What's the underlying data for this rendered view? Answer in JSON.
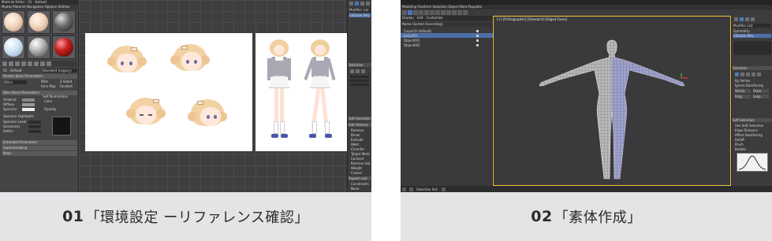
{
  "panels": [
    {
      "caption_num": "01",
      "caption_text": "「環境設定 ーリファレンス確認」",
      "material_editor": {
        "title": "Material Editor - 01 - Default",
        "menu": "Modes  Material  Navigation  Options  Utilities",
        "material_name": "01 - Default",
        "material_type": "Standard (Legacy)",
        "rollouts": [
          "Shader Basic Parameters",
          "Blinn Basic Parameters",
          "Extended Parameters",
          "SuperSampling",
          "Maps"
        ],
        "shader": "Blinn",
        "options": [
          "Wire",
          "2-Sided",
          "Face Map",
          "Faceted"
        ],
        "fields": [
          "Ambient",
          "Diffuse",
          "Specular"
        ],
        "self_illumination_label": "Self-Illumination",
        "color_label": "Color",
        "opacity_label": "Opacity",
        "specular_highlights": "Specular Highlights",
        "spec_fields": [
          "Specular Level",
          "Glossiness",
          "Soften"
        ]
      },
      "command_panel": {
        "modifier": "Modifier List",
        "object": "Editable Poly",
        "rollouts": [
          "Selection",
          "Soft Selection",
          "Edit Vertices",
          "Edit Geometry"
        ],
        "buttons": [
          "Remove",
          "Break",
          "Extrude",
          "Weld",
          "Chamfer",
          "Target Weld",
          "Connect",
          "Remove Isolated Vertices",
          "Weight",
          "Crease",
          "Repeat Last",
          "Constraints",
          "None"
        ]
      }
    },
    {
      "caption_num": "02",
      "caption_text": "「素体作成」",
      "menu": "Modeling  Freeform  Selection  Object Paint  Populate",
      "scene_explorer": {
        "tabs": [
          "Display",
          "Edit",
          "Customize"
        ],
        "header": "Name (Sorted Ascending)",
        "rows": [
          "[Layer]0 (default)",
          "body001",
          "Object001",
          "Object002"
        ],
        "selected_index": 1
      },
      "viewport_label": "[+] [Orthographic] [Standard] [Edged Faces]",
      "command_panel": {
        "modifier": "Modifier List",
        "stack": [
          "Symmetry",
          "Editable Poly"
        ],
        "rollouts": [
          "Selection",
          "Soft Selection"
        ],
        "selection_buttons": [
          "By Vertex",
          "Ignore Backfacing",
          "Shrink",
          "Grow",
          "Ring",
          "Loop"
        ],
        "soft_fields": [
          "Use Soft Selection",
          "Edge Distance",
          "Affect Backfacing",
          "Falloff",
          "Pinch",
          "Bubble"
        ]
      },
      "status": "Selection Set:"
    }
  ]
}
